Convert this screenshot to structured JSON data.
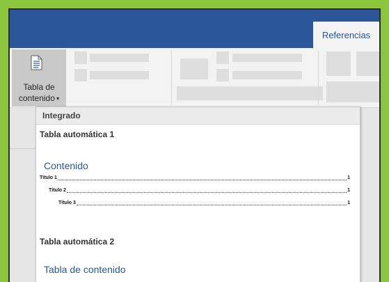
{
  "ribbon": {
    "active_tab": "Referencias",
    "toc_button": {
      "label_line1": "Tabla de",
      "label_line2": "contenido",
      "icon": "document-lines-icon"
    }
  },
  "dropdown": {
    "section": "Integrado",
    "options": [
      {
        "title": "Tabla automática 1",
        "heading": "Contenido",
        "entries": [
          {
            "text": "Título 1",
            "page": "1"
          },
          {
            "text": "Título 2",
            "page": "1"
          },
          {
            "text": "Título 3",
            "page": "1"
          }
        ]
      },
      {
        "title": "Tabla automática 2",
        "heading": "Tabla de contenido"
      }
    ]
  },
  "colors": {
    "title_bar": "#2b579a",
    "accent_text": "#2b579a",
    "outer_border": "#8cc63f"
  }
}
